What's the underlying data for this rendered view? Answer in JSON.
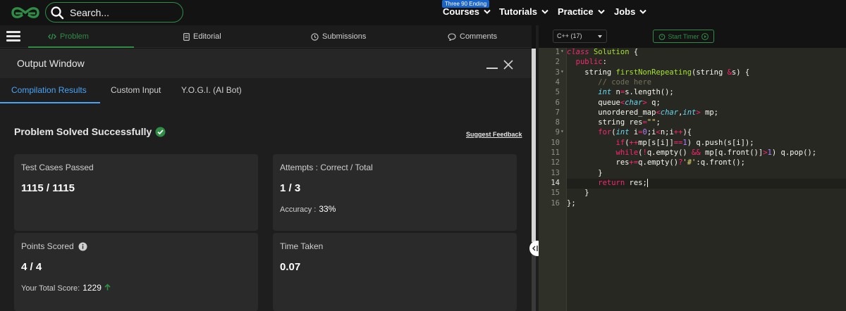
{
  "header": {
    "search_placeholder": "Search...",
    "promo_badge": "Three 90 Ending",
    "nav": [
      "Courses",
      "Tutorials",
      "Practice",
      "Jobs"
    ]
  },
  "problem_tabs": [
    "Problem",
    "Editorial",
    "Submissions",
    "Comments"
  ],
  "output_window": {
    "title": "Output Window",
    "tabs": [
      "Compilation Results",
      "Custom Input",
      "Y.O.G.I. (AI Bot)"
    ],
    "status": "Problem Solved Successfully",
    "suggest_feedback": "Suggest Feedback",
    "cards": {
      "test_cases": {
        "label": "Test Cases Passed",
        "value": "1115 / 1115"
      },
      "attempts": {
        "label": "Attempts : Correct / Total",
        "value": "1 / 3",
        "sub_label": "Accuracy :",
        "sub_value": "33%"
      },
      "points": {
        "label": "Points Scored",
        "value": "4 / 4",
        "sub_label": "Your Total Score:",
        "sub_value": "1229"
      },
      "time": {
        "label": "Time Taken",
        "value": "0.07"
      }
    }
  },
  "editor": {
    "language": "C++ (17)",
    "timer_label": "Start Timer",
    "active_line": 14,
    "line_numbers": [
      "1",
      "2",
      "3",
      "4",
      "5",
      "6",
      "7",
      "8",
      "9",
      "10",
      "11",
      "12",
      "13",
      "14",
      "15",
      "16"
    ],
    "fold_lines": [
      1,
      3,
      9
    ]
  },
  "colors": {
    "brand_green": "#2f8d46",
    "tab_blue": "#4aa3f5",
    "success_green": "#2f8d46"
  }
}
